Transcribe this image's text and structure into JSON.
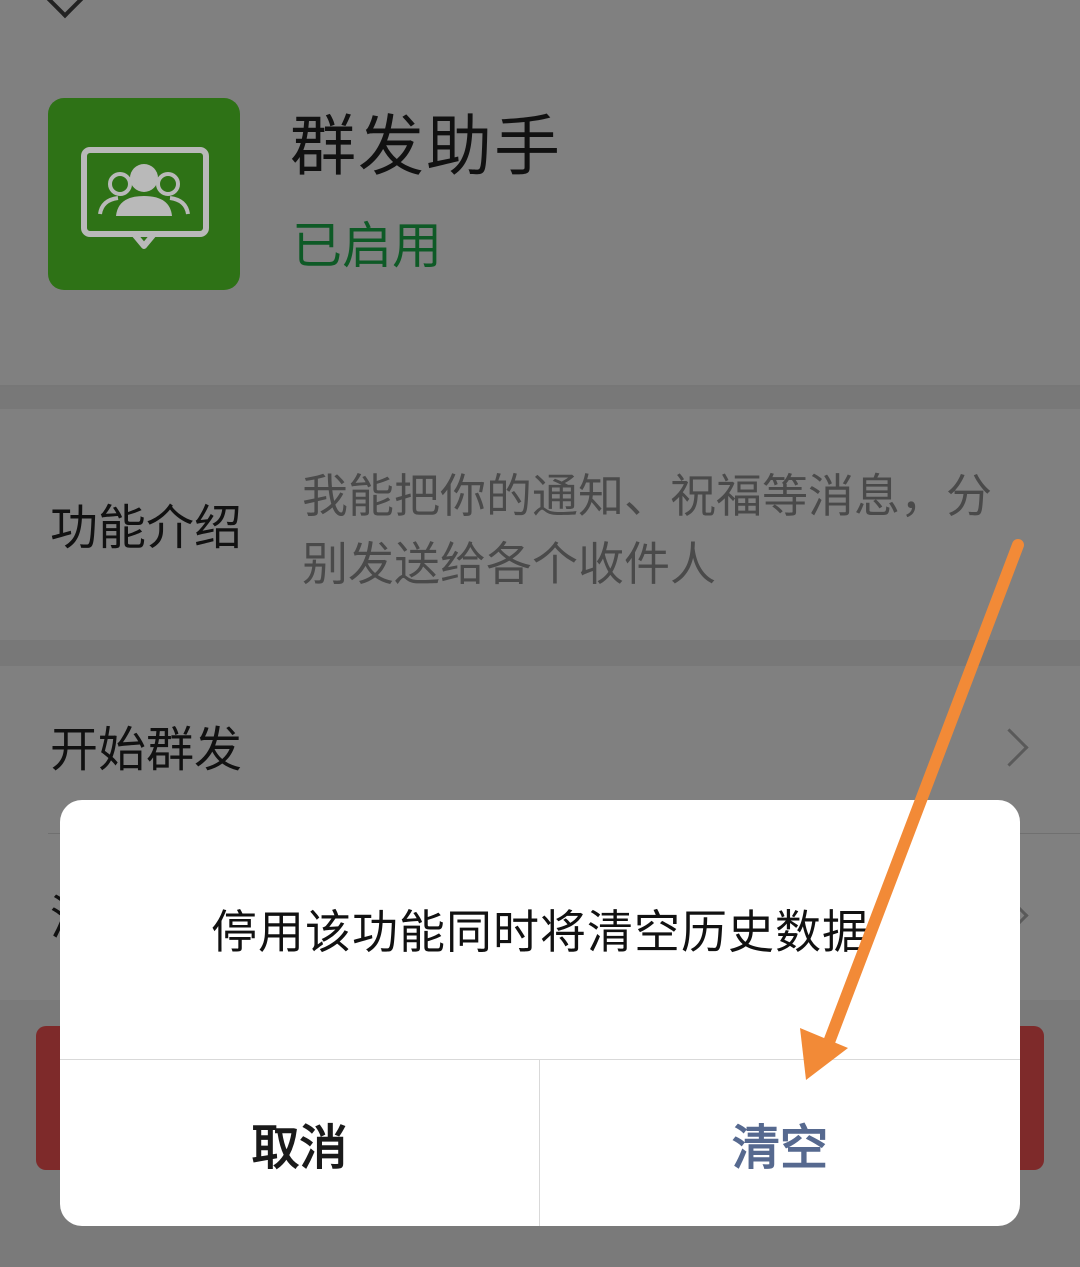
{
  "header": {
    "app_name": "群发助手",
    "status": "已启用",
    "icon": "group-chat-icon",
    "icon_color": "#2e7216"
  },
  "intro": {
    "label": "功能介绍",
    "text": "我能把你的通知、祝福等消息，分别发送给各个收件人"
  },
  "menu": {
    "start_label": "开始群发",
    "clear_label_partial": "清"
  },
  "dialog": {
    "message": "停用该功能同时将清空历史数据",
    "cancel_label": "取消",
    "confirm_label": "清空",
    "confirm_color": "#56698f"
  },
  "annotation": {
    "arrow_color": "#f28a37",
    "points_to": "清空"
  }
}
